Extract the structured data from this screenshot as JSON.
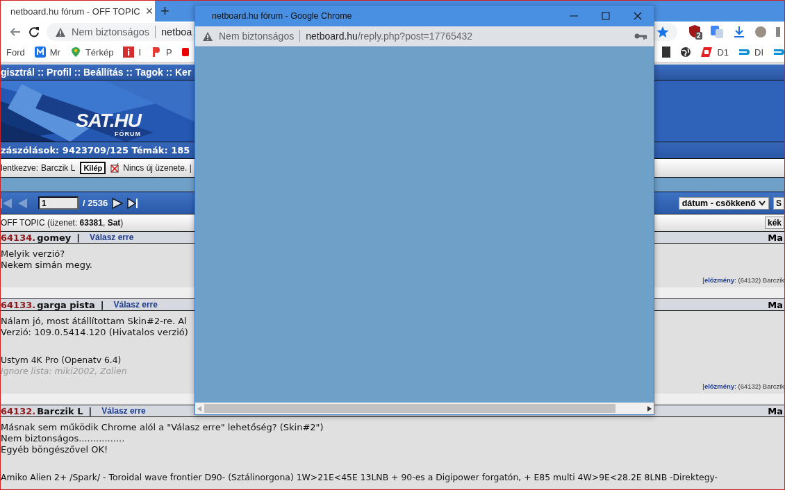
{
  "browser": {
    "tab": {
      "title": "netboard.hu fórum - OFF TOPIC",
      "close": "×"
    },
    "new_tab": "+",
    "address": {
      "security": "Nem biztonságos",
      "url": "netboa"
    },
    "extension_badge": "2",
    "bookmarks_left": [
      {
        "label": "Ford"
      },
      {
        "label": "Mr"
      },
      {
        "label": "Térkép"
      },
      {
        "label": "I"
      },
      {
        "label": "P"
      }
    ],
    "bookmarks_right": [
      {
        "label": "D1"
      },
      {
        "label": "DI"
      }
    ]
  },
  "forum": {
    "nav": "gisztrál :: Profil :: Beállítás :: Tagok :: Ker",
    "logo": {
      "title": "SAT.HU",
      "subtitle": "FÓRUM"
    },
    "stats": "zászólások: 9423709/125 Témák: 185",
    "login": {
      "prefix": "lentkezve:",
      "user": "Barczik L",
      "logout": "Kilép",
      "messages": "Nincs új üzenete. |"
    },
    "pager": {
      "page": "1",
      "total": "/ 2536",
      "sort": "dátum - csökkenő",
      "go": "S"
    },
    "topic": {
      "title": "OFF TOPIC (üzenet: **63381**, **Sat**)",
      "button": "kék"
    },
    "posts": [
      {
        "number": "64134.",
        "author": "gomey",
        "separator": "|",
        "reply": "Válasz erre",
        "date": "Ma",
        "paragraphs": [
          [
            "Melyik verzió?",
            "Nekem simán megy."
          ]
        ],
        "footer": "[**előzmény**: (64132) Barczik"
      },
      {
        "number": "64133.",
        "author": "garga pista",
        "separator": "|",
        "reply": "Válasz erre",
        "date": "Ma",
        "paragraphs": [
          [
            "Nálam jó, most átállítottam Skin#2-re. Al",
            "Verzió: 109.0.5414.120 (Hivatalos verzió)"
          ]
        ],
        "signature": [
          "Ustym 4K Pro (Openatv 6.4)"
        ],
        "ignore": "Ignore lista: miki2002, Zolien",
        "footer": "[**előzmény**: (64132) Barczik"
      },
      {
        "number": "64132.",
        "author": "Barczik L",
        "separator": "|",
        "reply": "Válasz erre",
        "date": "Ma",
        "paragraphs": [
          [
            "Másnak sem működik Chrome alól a \"Válasz erre\" lehetőség? (Skin#2\")",
            "Nem biztonságos................",
            "Egyéb böngészővel OK!"
          ]
        ],
        "signature": [
          "Amiko Alien 2+ /Spark/ - Toroidal wave frontier D90- (Sztálinorgona) 1W>21E<45E 13LNB + 90-es a Digipower forgatón, + E85 multi 4W>9E<28.2E 8LNB -Direktegy-"
        ]
      }
    ]
  },
  "popup": {
    "title": "netboard.hu fórum - Google Chrome",
    "security": "Nem biztonságos",
    "url_host": "netboard.hu",
    "url_path": "/reply.php?post=17765432"
  }
}
